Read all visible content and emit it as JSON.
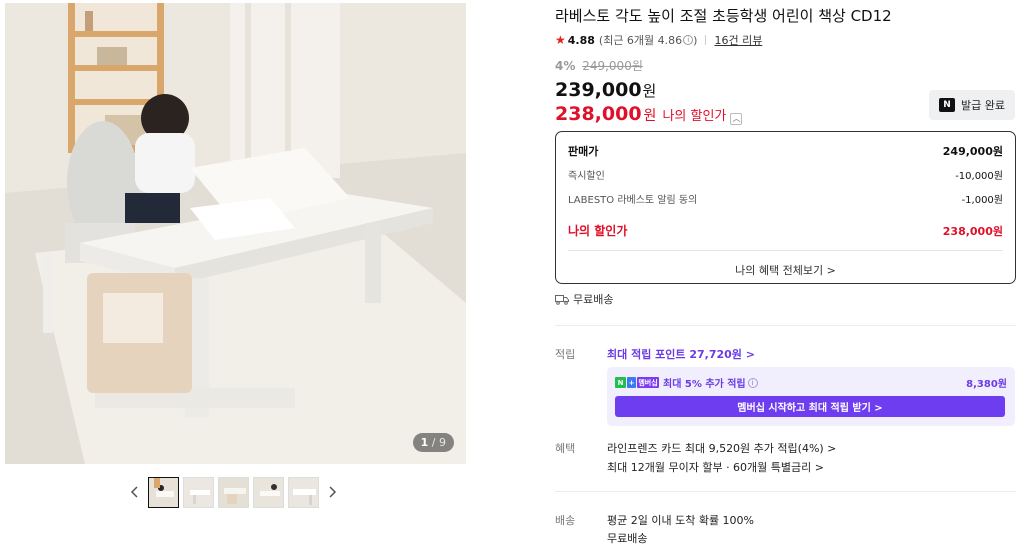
{
  "gallery": {
    "current_page": "1",
    "total_pages": "/ 9",
    "prev_icon": "chevron-left-icon",
    "next_icon": "chevron-right-icon",
    "thumbnail_count": 5
  },
  "product": {
    "title": "라베스토 각도 높이 조절 초등학생 어린이 책상 CD12",
    "rating": {
      "score": "4.88",
      "recent": "(최근 6개월 4.86",
      "recent_close": ")",
      "reviews": "16건 리뷰"
    },
    "discount_rate": "4%",
    "original_price": "249,000원",
    "price": "239,000",
    "price_unit": "원",
    "my_price": "238,000",
    "my_price_unit": "원",
    "my_price_label": "나의 할인가",
    "coupon_button": "발급 완료",
    "coupon_badge": "N"
  },
  "breakdown": {
    "rows": [
      {
        "label": "판매가",
        "value": "249,000원"
      },
      {
        "label": "즉시할인",
        "value": "-10,000원"
      },
      {
        "label": "LABESTO 라베스토 알림 동의",
        "value": "-1,000원"
      }
    ],
    "total_label": "나의 할인가",
    "total_value": "238,000원",
    "view_all": "나의 혜택 전체보기 >"
  },
  "free_shipping": "무료배송",
  "points": {
    "label": "적립",
    "max_point": "최대 적립 포인트 27,720원 >",
    "membership_text": "최대 5% 추가 적립",
    "membership_amount": "8,380원",
    "membership_badge": "멤버십",
    "membership_button": "멤버십 시작하고 최대 적립 받기 >"
  },
  "benefits": {
    "label": "혜택",
    "item1": "라인프렌즈 카드 최대 9,520원 추가 적립(4%) >",
    "item2": "최대 12개월 무이자 할부 · 60개월 특별금리 >"
  },
  "delivery": {
    "label": "배송",
    "line1": "평균 2일 이내 도착 확률 100%",
    "line2": "무료배송"
  },
  "colors": {
    "sale_red": "#e0102a",
    "membership_purple": "#6f3df0",
    "star_red": "#e52222"
  }
}
